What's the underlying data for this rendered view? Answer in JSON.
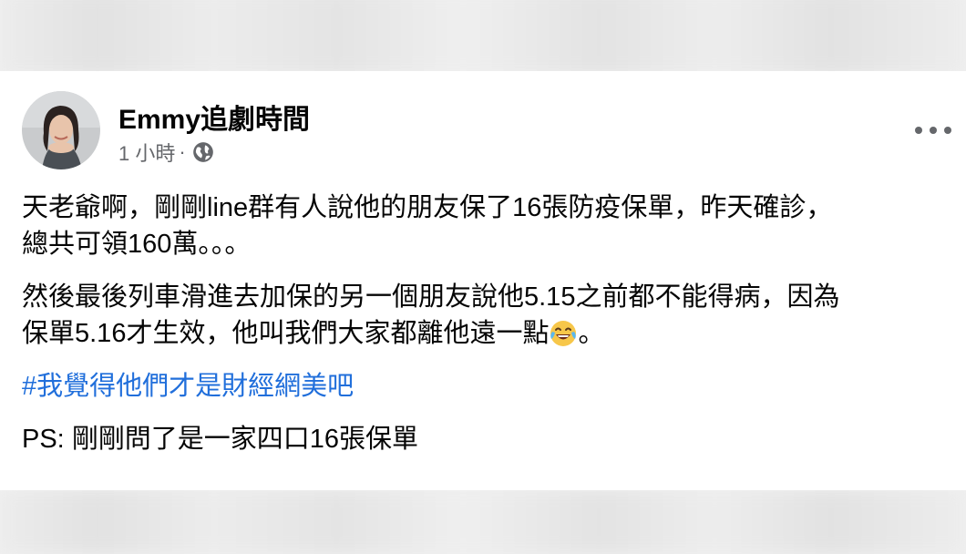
{
  "post": {
    "author_name": "Emmy追劇時間",
    "timestamp": "1 小時",
    "separator": "·",
    "privacy_icon": "globe-icon",
    "more_icon": "more-options-icon",
    "paragraph1": {
      "line1": "天老爺啊，剛剛line群有人說他的朋友保了16張防疫保單，昨天確診，",
      "line2": "總共可領160萬。。。"
    },
    "paragraph2": {
      "line1": "然後最後列車滑進去加保的另一個朋友說他5.15之前都不能得病，因為",
      "line2_before_emoji": "保單5.16才生效，他叫我們大家都離他遠一點",
      "emoji": "laughing-tears-emoji",
      "line2_after_emoji": "。"
    },
    "hashtag": "#我覺得他們才是財經網美吧",
    "ps": "PS: 剛剛問了是一家四口16張保單"
  },
  "colors": {
    "text": "#050505",
    "secondary": "#65676b",
    "hashtag": "#216fdb"
  }
}
